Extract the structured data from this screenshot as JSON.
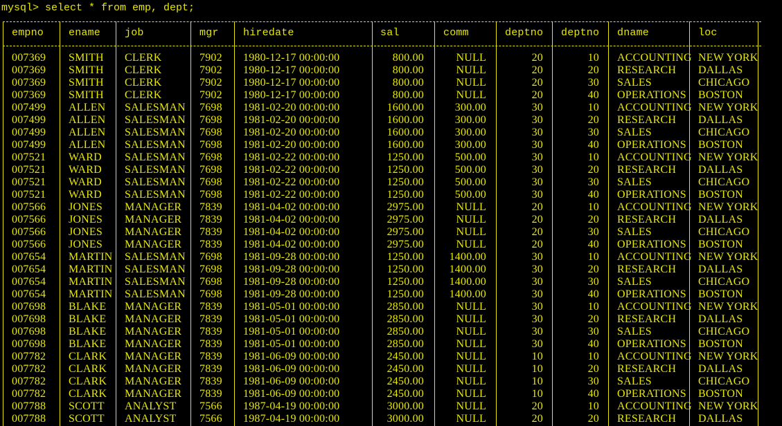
{
  "terminal": {
    "prompt": "mysql> select * from emp, dept;"
  },
  "table": {
    "columns": [
      "empno",
      "ename",
      "job",
      "mgr",
      "hiredate",
      "sal",
      "comm",
      "deptno",
      "deptno",
      "dname",
      "loc"
    ],
    "rows": [
      [
        "007369",
        "SMITH",
        "CLERK",
        "7902",
        "1980-12-17 00:00:00",
        "800.00",
        "NULL",
        "20",
        "10",
        "ACCOUNTING",
        "NEW YORK"
      ],
      [
        "007369",
        "SMITH",
        "CLERK",
        "7902",
        "1980-12-17 00:00:00",
        "800.00",
        "NULL",
        "20",
        "20",
        "RESEARCH",
        "DALLAS"
      ],
      [
        "007369",
        "SMITH",
        "CLERK",
        "7902",
        "1980-12-17 00:00:00",
        "800.00",
        "NULL",
        "20",
        "30",
        "SALES",
        "CHICAGO"
      ],
      [
        "007369",
        "SMITH",
        "CLERK",
        "7902",
        "1980-12-17 00:00:00",
        "800.00",
        "NULL",
        "20",
        "40",
        "OPERATIONS",
        "BOSTON"
      ],
      [
        "007499",
        "ALLEN",
        "SALESMAN",
        "7698",
        "1981-02-20 00:00:00",
        "1600.00",
        "300.00",
        "30",
        "10",
        "ACCOUNTING",
        "NEW YORK"
      ],
      [
        "007499",
        "ALLEN",
        "SALESMAN",
        "7698",
        "1981-02-20 00:00:00",
        "1600.00",
        "300.00",
        "30",
        "20",
        "RESEARCH",
        "DALLAS"
      ],
      [
        "007499",
        "ALLEN",
        "SALESMAN",
        "7698",
        "1981-02-20 00:00:00",
        "1600.00",
        "300.00",
        "30",
        "30",
        "SALES",
        "CHICAGO"
      ],
      [
        "007499",
        "ALLEN",
        "SALESMAN",
        "7698",
        "1981-02-20 00:00:00",
        "1600.00",
        "300.00",
        "30",
        "40",
        "OPERATIONS",
        "BOSTON"
      ],
      [
        "007521",
        "WARD",
        "SALESMAN",
        "7698",
        "1981-02-22 00:00:00",
        "1250.00",
        "500.00",
        "30",
        "10",
        "ACCOUNTING",
        "NEW YORK"
      ],
      [
        "007521",
        "WARD",
        "SALESMAN",
        "7698",
        "1981-02-22 00:00:00",
        "1250.00",
        "500.00",
        "30",
        "20",
        "RESEARCH",
        "DALLAS"
      ],
      [
        "007521",
        "WARD",
        "SALESMAN",
        "7698",
        "1981-02-22 00:00:00",
        "1250.00",
        "500.00",
        "30",
        "30",
        "SALES",
        "CHICAGO"
      ],
      [
        "007521",
        "WARD",
        "SALESMAN",
        "7698",
        "1981-02-22 00:00:00",
        "1250.00",
        "500.00",
        "30",
        "40",
        "OPERATIONS",
        "BOSTON"
      ],
      [
        "007566",
        "JONES",
        "MANAGER",
        "7839",
        "1981-04-02 00:00:00",
        "2975.00",
        "NULL",
        "20",
        "10",
        "ACCOUNTING",
        "NEW YORK"
      ],
      [
        "007566",
        "JONES",
        "MANAGER",
        "7839",
        "1981-04-02 00:00:00",
        "2975.00",
        "NULL",
        "20",
        "20",
        "RESEARCH",
        "DALLAS"
      ],
      [
        "007566",
        "JONES",
        "MANAGER",
        "7839",
        "1981-04-02 00:00:00",
        "2975.00",
        "NULL",
        "20",
        "30",
        "SALES",
        "CHICAGO"
      ],
      [
        "007566",
        "JONES",
        "MANAGER",
        "7839",
        "1981-04-02 00:00:00",
        "2975.00",
        "NULL",
        "20",
        "40",
        "OPERATIONS",
        "BOSTON"
      ],
      [
        "007654",
        "MARTIN",
        "SALESMAN",
        "7698",
        "1981-09-28 00:00:00",
        "1250.00",
        "1400.00",
        "30",
        "10",
        "ACCOUNTING",
        "NEW YORK"
      ],
      [
        "007654",
        "MARTIN",
        "SALESMAN",
        "7698",
        "1981-09-28 00:00:00",
        "1250.00",
        "1400.00",
        "30",
        "20",
        "RESEARCH",
        "DALLAS"
      ],
      [
        "007654",
        "MARTIN",
        "SALESMAN",
        "7698",
        "1981-09-28 00:00:00",
        "1250.00",
        "1400.00",
        "30",
        "30",
        "SALES",
        "CHICAGO"
      ],
      [
        "007654",
        "MARTIN",
        "SALESMAN",
        "7698",
        "1981-09-28 00:00:00",
        "1250.00",
        "1400.00",
        "30",
        "40",
        "OPERATIONS",
        "BOSTON"
      ],
      [
        "007698",
        "BLAKE",
        "MANAGER",
        "7839",
        "1981-05-01 00:00:00",
        "2850.00",
        "NULL",
        "30",
        "10",
        "ACCOUNTING",
        "NEW YORK"
      ],
      [
        "007698",
        "BLAKE",
        "MANAGER",
        "7839",
        "1981-05-01 00:00:00",
        "2850.00",
        "NULL",
        "30",
        "20",
        "RESEARCH",
        "DALLAS"
      ],
      [
        "007698",
        "BLAKE",
        "MANAGER",
        "7839",
        "1981-05-01 00:00:00",
        "2850.00",
        "NULL",
        "30",
        "30",
        "SALES",
        "CHICAGO"
      ],
      [
        "007698",
        "BLAKE",
        "MANAGER",
        "7839",
        "1981-05-01 00:00:00",
        "2850.00",
        "NULL",
        "30",
        "40",
        "OPERATIONS",
        "BOSTON"
      ],
      [
        "007782",
        "CLARK",
        "MANAGER",
        "7839",
        "1981-06-09 00:00:00",
        "2450.00",
        "NULL",
        "10",
        "10",
        "ACCOUNTING",
        "NEW YORK"
      ],
      [
        "007782",
        "CLARK",
        "MANAGER",
        "7839",
        "1981-06-09 00:00:00",
        "2450.00",
        "NULL",
        "10",
        "20",
        "RESEARCH",
        "DALLAS"
      ],
      [
        "007782",
        "CLARK",
        "MANAGER",
        "7839",
        "1981-06-09 00:00:00",
        "2450.00",
        "NULL",
        "10",
        "30",
        "SALES",
        "CHICAGO"
      ],
      [
        "007782",
        "CLARK",
        "MANAGER",
        "7839",
        "1981-06-09 00:00:00",
        "2450.00",
        "NULL",
        "10",
        "40",
        "OPERATIONS",
        "BOSTON"
      ],
      [
        "007788",
        "SCOTT",
        "ANALYST",
        "7566",
        "1987-04-19 00:00:00",
        "3000.00",
        "NULL",
        "20",
        "10",
        "ACCOUNTING",
        "NEW YORK"
      ],
      [
        "007788",
        "SCOTT",
        "ANALYST",
        "7566",
        "1987-04-19 00:00:00",
        "3000.00",
        "NULL",
        "20",
        "20",
        "RESEARCH",
        "DALLAS"
      ]
    ]
  },
  "colors": {
    "background": "#000000",
    "text": "#e8e800"
  }
}
